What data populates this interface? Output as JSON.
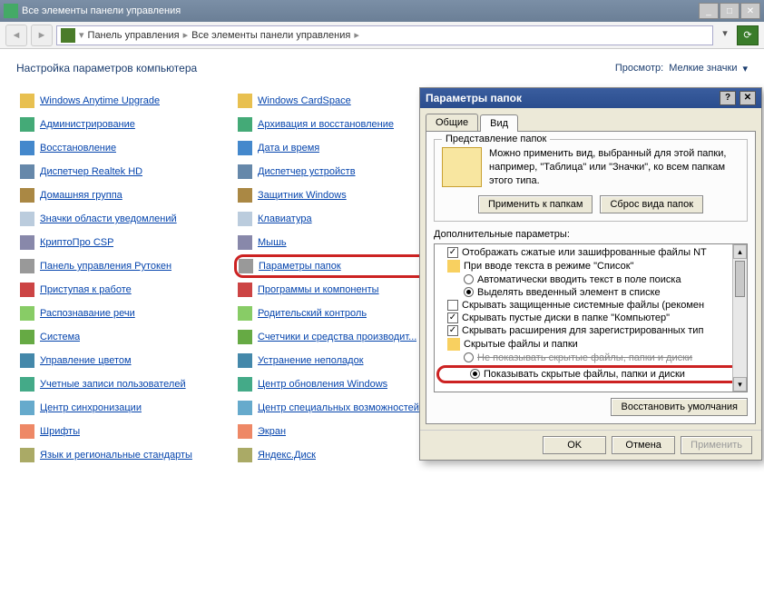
{
  "window": {
    "title": "Все элементы панели управления"
  },
  "nav": {
    "crumb1": "Панель управления",
    "crumb2": "Все элементы панели управления"
  },
  "heading": "Настройка параметров компьютера",
  "view": {
    "label": "Просмотр:",
    "value": "Мелкие значки"
  },
  "col1": [
    "Windows Anytime Upgrade",
    "Администрирование",
    "Восстановление",
    "Диспетчер Realtek HD",
    "Домашняя группа",
    "Значки области уведомлений",
    "КриптоПро CSP",
    "Панель управления Рутокен",
    "Приступая к работе",
    "Распознавание речи",
    "Система",
    "Управление цветом",
    "Учетные записи пользователей",
    "Центр синхронизации",
    "Шрифты",
    "Язык и региональные стандарты"
  ],
  "col2": [
    "Windows CardSpace",
    "Архивация и восстановление",
    "Дата и время",
    "Диспетчер устройств",
    "Защитник Windows",
    "Клавиатура",
    "Мышь",
    "Параметры папок",
    "Программы и компоненты",
    "Родительский контроль",
    "Счетчики и средства производит...",
    "Устранение неполадок",
    "Центр обновления Windows",
    "Центр специальных возможностей",
    "Экран",
    "Яндекс.Диск"
  ],
  "highlight_col2_index": 7,
  "dialog": {
    "title": "Параметры папок",
    "tabs": {
      "t1": "Общие",
      "t2": "Вид"
    },
    "group_legend": "Представление папок",
    "group_text": "Можно применить вид, выбранный для этой папки, например, \"Таблица\" или \"Значки\", ко всем папкам этого типа.",
    "btn_apply": "Применить к папкам",
    "btn_reset": "Сброс вида папок",
    "adv_label": "Дополнительные параметры:",
    "tree": [
      {
        "t": "chk",
        "c": true,
        "i": 0,
        "txt": "Отображать сжатые или зашифрованные файлы NT"
      },
      {
        "t": "fld",
        "i": 0,
        "txt": "При вводе текста в режиме \"Список\""
      },
      {
        "t": "rdo",
        "c": false,
        "i": 1,
        "txt": "Автоматически вводить текст в поле поиска"
      },
      {
        "t": "rdo",
        "c": true,
        "i": 1,
        "txt": "Выделять введенный элемент в списке"
      },
      {
        "t": "chk",
        "c": false,
        "i": 0,
        "txt": "Скрывать защищенные системные файлы (рекомен"
      },
      {
        "t": "chk",
        "c": true,
        "i": 0,
        "txt": "Скрывать пустые диски в папке \"Компьютер\""
      },
      {
        "t": "chk",
        "c": true,
        "i": 0,
        "txt": "Скрывать расширения для зарегистрированных тип"
      },
      {
        "t": "fld",
        "i": 0,
        "txt": "Скрытые файлы и папки"
      },
      {
        "t": "rdo",
        "c": false,
        "i": 1,
        "txt": "Не показывать скрытые файлы, папки и диски",
        "strike": true
      },
      {
        "t": "rdo",
        "c": true,
        "i": 1,
        "txt": "Показывать скрытые файлы, папки и диски",
        "hl": true
      }
    ],
    "btn_defaults": "Восстановить умолчания",
    "ok": "OK",
    "cancel": "Отмена",
    "apply": "Применить"
  }
}
